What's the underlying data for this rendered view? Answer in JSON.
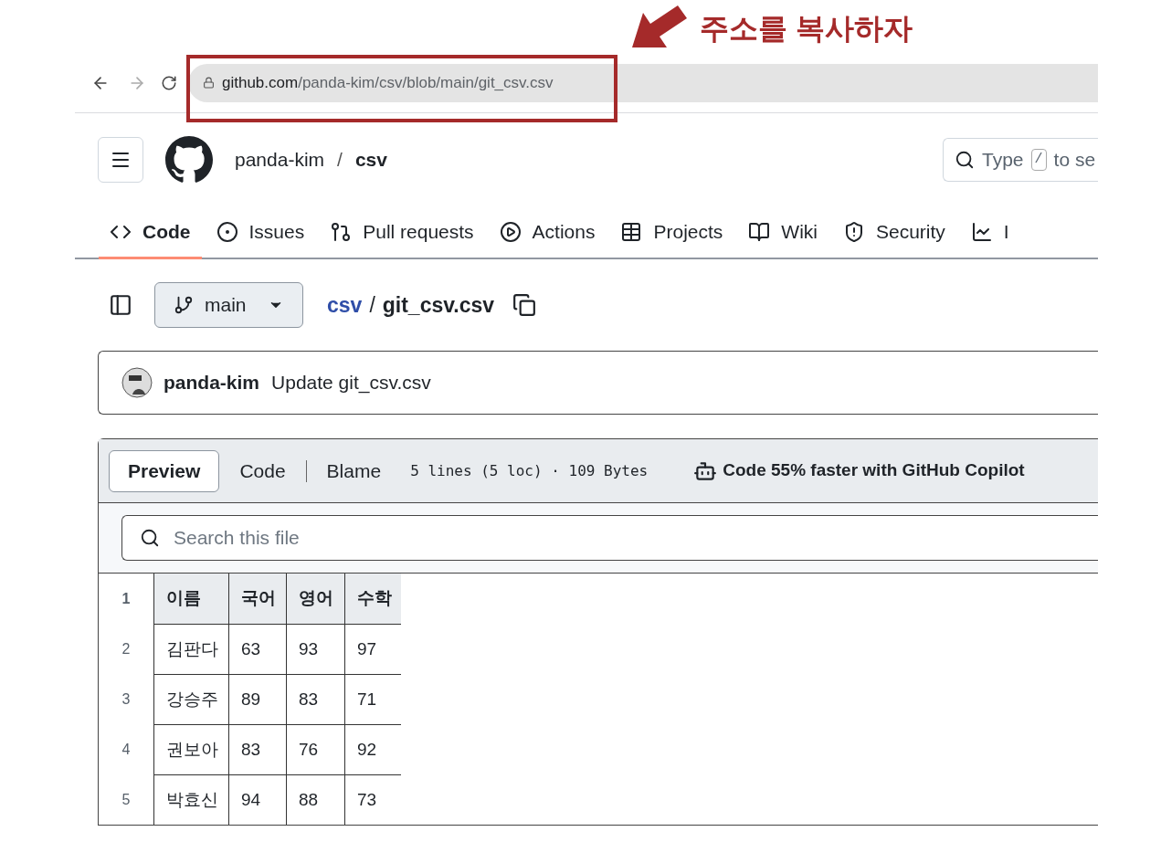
{
  "annotation": {
    "label": "주소를 복사하자"
  },
  "browser": {
    "url_host": "github.com",
    "url_path": "/panda-kim/csv/blob/main/git_csv.csv"
  },
  "repo_header": {
    "owner": "panda-kim",
    "separator": "/",
    "repo": "csv",
    "search": {
      "prefix": "Type",
      "key": "/",
      "suffix": "to se"
    }
  },
  "tabs": [
    {
      "label": "Code",
      "selected": true
    },
    {
      "label": "Issues",
      "selected": false
    },
    {
      "label": "Pull requests",
      "selected": false
    },
    {
      "label": "Actions",
      "selected": false
    },
    {
      "label": "Projects",
      "selected": false
    },
    {
      "label": "Wiki",
      "selected": false
    },
    {
      "label": "Security",
      "selected": false
    },
    {
      "label": "I",
      "selected": false
    }
  ],
  "file_nav": {
    "branch": "main",
    "breadcrumb_repo": "csv",
    "separator": "/",
    "file_name": "git_csv.csv"
  },
  "commit": {
    "author": "panda-kim",
    "message": "Update git_csv.csv"
  },
  "file_view": {
    "modes": [
      {
        "label": "Preview",
        "selected": true
      },
      {
        "label": "Code",
        "selected": false
      },
      {
        "label": "Blame",
        "selected": false
      }
    ],
    "info": "5 lines (5 loc) · 109 Bytes",
    "copilot": "Code 55% faster with GitHub Copilot",
    "search_placeholder": "Search this file",
    "table": {
      "header": {
        "line": "1",
        "cells": [
          "이름",
          "국어",
          "영어",
          "수학"
        ]
      },
      "rows": [
        {
          "line": "2",
          "cells": [
            "김판다",
            "63",
            "93",
            "97"
          ]
        },
        {
          "line": "3",
          "cells": [
            "강승주",
            "89",
            "83",
            "71"
          ]
        },
        {
          "line": "4",
          "cells": [
            "권보아",
            "83",
            "76",
            "92"
          ]
        },
        {
          "line": "5",
          "cells": [
            "박효신",
            "94",
            "88",
            "73"
          ]
        }
      ]
    }
  }
}
